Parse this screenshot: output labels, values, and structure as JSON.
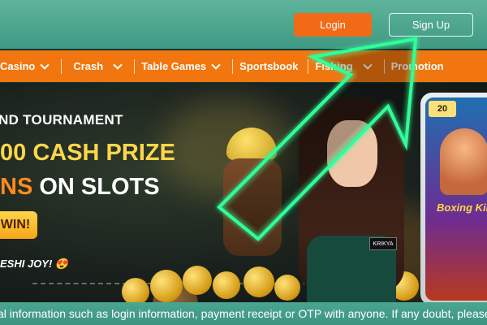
{
  "header": {
    "login_label": "Login",
    "signup_label": "Sign Up"
  },
  "nav": {
    "items": [
      {
        "label": "Casino"
      },
      {
        "label": "Crash"
      },
      {
        "label": "Table Games"
      },
      {
        "label": "Sportsbook"
      },
      {
        "label": "Fishing"
      },
      {
        "label": "Promotion"
      }
    ]
  },
  "banner": {
    "line1": "ND TOURNAMENT",
    "line2": "00 CASH PRIZE",
    "line3_accent": "NS",
    "line3_rest": " ON SLOTS",
    "cta": "WIN!",
    "tagline": "ESHI JOY! 😍",
    "phone_label": "20",
    "phone_title": "Boxing King",
    "badge": "KRIKYA"
  },
  "notice": {
    "text": "al information such as login information, payment receipt or OTP with anyone. If any doubt, please"
  },
  "colors": {
    "accent_orange": "#f2760f",
    "header_teal": "#4aa690",
    "glow_green": "#2fff9a"
  }
}
